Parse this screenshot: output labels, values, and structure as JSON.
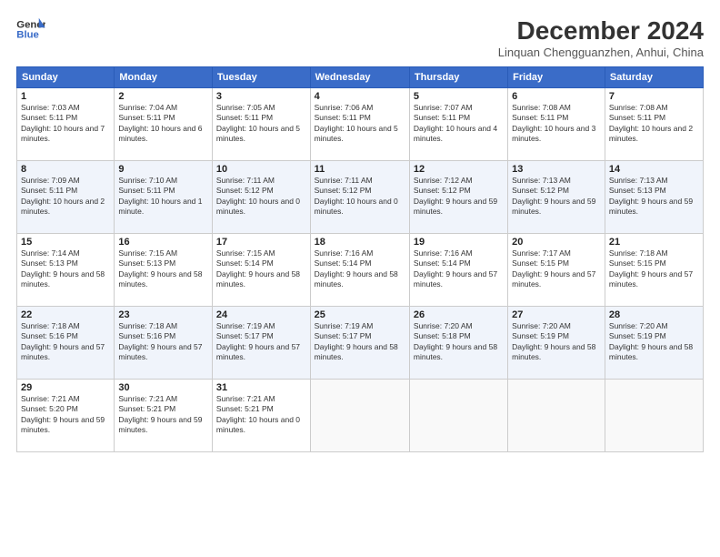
{
  "header": {
    "logo_line1": "General",
    "logo_line2": "Blue",
    "month": "December 2024",
    "location": "Linquan Chengguanzhen, Anhui, China"
  },
  "weekdays": [
    "Sunday",
    "Monday",
    "Tuesday",
    "Wednesday",
    "Thursday",
    "Friday",
    "Saturday"
  ],
  "weeks": [
    [
      {
        "day": "1",
        "sunrise": "7:03 AM",
        "sunset": "5:11 PM",
        "daylight": "10 hours and 7 minutes."
      },
      {
        "day": "2",
        "sunrise": "7:04 AM",
        "sunset": "5:11 PM",
        "daylight": "10 hours and 6 minutes."
      },
      {
        "day": "3",
        "sunrise": "7:05 AM",
        "sunset": "5:11 PM",
        "daylight": "10 hours and 5 minutes."
      },
      {
        "day": "4",
        "sunrise": "7:06 AM",
        "sunset": "5:11 PM",
        "daylight": "10 hours and 5 minutes."
      },
      {
        "day": "5",
        "sunrise": "7:07 AM",
        "sunset": "5:11 PM",
        "daylight": "10 hours and 4 minutes."
      },
      {
        "day": "6",
        "sunrise": "7:08 AM",
        "sunset": "5:11 PM",
        "daylight": "10 hours and 3 minutes."
      },
      {
        "day": "7",
        "sunrise": "7:08 AM",
        "sunset": "5:11 PM",
        "daylight": "10 hours and 2 minutes."
      }
    ],
    [
      {
        "day": "8",
        "sunrise": "7:09 AM",
        "sunset": "5:11 PM",
        "daylight": "10 hours and 2 minutes."
      },
      {
        "day": "9",
        "sunrise": "7:10 AM",
        "sunset": "5:11 PM",
        "daylight": "10 hours and 1 minute."
      },
      {
        "day": "10",
        "sunrise": "7:11 AM",
        "sunset": "5:12 PM",
        "daylight": "10 hours and 0 minutes."
      },
      {
        "day": "11",
        "sunrise": "7:11 AM",
        "sunset": "5:12 PM",
        "daylight": "10 hours and 0 minutes."
      },
      {
        "day": "12",
        "sunrise": "7:12 AM",
        "sunset": "5:12 PM",
        "daylight": "9 hours and 59 minutes."
      },
      {
        "day": "13",
        "sunrise": "7:13 AM",
        "sunset": "5:12 PM",
        "daylight": "9 hours and 59 minutes."
      },
      {
        "day": "14",
        "sunrise": "7:13 AM",
        "sunset": "5:13 PM",
        "daylight": "9 hours and 59 minutes."
      }
    ],
    [
      {
        "day": "15",
        "sunrise": "7:14 AM",
        "sunset": "5:13 PM",
        "daylight": "9 hours and 58 minutes."
      },
      {
        "day": "16",
        "sunrise": "7:15 AM",
        "sunset": "5:13 PM",
        "daylight": "9 hours and 58 minutes."
      },
      {
        "day": "17",
        "sunrise": "7:15 AM",
        "sunset": "5:14 PM",
        "daylight": "9 hours and 58 minutes."
      },
      {
        "day": "18",
        "sunrise": "7:16 AM",
        "sunset": "5:14 PM",
        "daylight": "9 hours and 58 minutes."
      },
      {
        "day": "19",
        "sunrise": "7:16 AM",
        "sunset": "5:14 PM",
        "daylight": "9 hours and 57 minutes."
      },
      {
        "day": "20",
        "sunrise": "7:17 AM",
        "sunset": "5:15 PM",
        "daylight": "9 hours and 57 minutes."
      },
      {
        "day": "21",
        "sunrise": "7:18 AM",
        "sunset": "5:15 PM",
        "daylight": "9 hours and 57 minutes."
      }
    ],
    [
      {
        "day": "22",
        "sunrise": "7:18 AM",
        "sunset": "5:16 PM",
        "daylight": "9 hours and 57 minutes."
      },
      {
        "day": "23",
        "sunrise": "7:18 AM",
        "sunset": "5:16 PM",
        "daylight": "9 hours and 57 minutes."
      },
      {
        "day": "24",
        "sunrise": "7:19 AM",
        "sunset": "5:17 PM",
        "daylight": "9 hours and 57 minutes."
      },
      {
        "day": "25",
        "sunrise": "7:19 AM",
        "sunset": "5:17 PM",
        "daylight": "9 hours and 58 minutes."
      },
      {
        "day": "26",
        "sunrise": "7:20 AM",
        "sunset": "5:18 PM",
        "daylight": "9 hours and 58 minutes."
      },
      {
        "day": "27",
        "sunrise": "7:20 AM",
        "sunset": "5:19 PM",
        "daylight": "9 hours and 58 minutes."
      },
      {
        "day": "28",
        "sunrise": "7:20 AM",
        "sunset": "5:19 PM",
        "daylight": "9 hours and 58 minutes."
      }
    ],
    [
      {
        "day": "29",
        "sunrise": "7:21 AM",
        "sunset": "5:20 PM",
        "daylight": "9 hours and 59 minutes."
      },
      {
        "day": "30",
        "sunrise": "7:21 AM",
        "sunset": "5:21 PM",
        "daylight": "9 hours and 59 minutes."
      },
      {
        "day": "31",
        "sunrise": "7:21 AM",
        "sunset": "5:21 PM",
        "daylight": "10 hours and 0 minutes."
      },
      null,
      null,
      null,
      null
    ]
  ]
}
